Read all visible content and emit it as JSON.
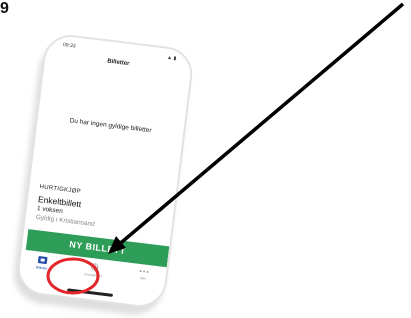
{
  "corner_glyph": "9",
  "status_bar": {
    "time": "09:33",
    "icons": "▲ ▮"
  },
  "header": {
    "title": "Billetter"
  },
  "empty_message": "Du har ingen gyldige billetter",
  "quick_buy": {
    "section_label": "HURTIGKJØP",
    "ticket_name": "Enkeltbillett",
    "passengers": "1 voksen",
    "zone": "Gyldig i Kristiansand"
  },
  "primary_button": {
    "label": "NY BILLETT",
    "color": "#2e9d58"
  },
  "tabs": [
    {
      "label": "Billetter",
      "icon": "ticket-icon",
      "active": true
    },
    {
      "label": "Innstillinger",
      "icon": "gear-icon",
      "active": false
    },
    {
      "label": "Mer",
      "icon": "more-dots-icon",
      "active": false
    }
  ],
  "annotation": {
    "arrow_color": "#000000",
    "circle_color": "#e3262a"
  }
}
